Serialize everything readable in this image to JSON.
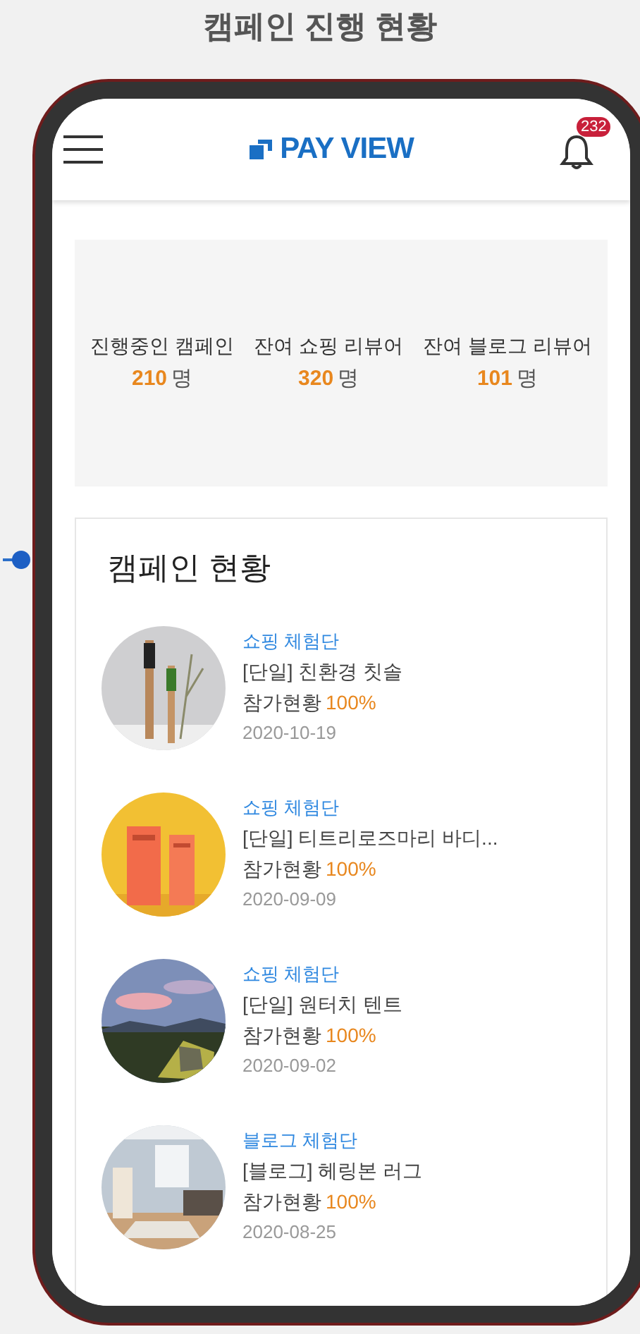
{
  "page_title": "캠페인 진행 현황",
  "header": {
    "logo": "PAY VIEW",
    "notification_count": "232"
  },
  "stats": [
    {
      "label": "진행중인 캠페인",
      "value": "210",
      "unit": "명"
    },
    {
      "label": "잔여 쇼핑 리뷰어",
      "value": "320",
      "unit": "명"
    },
    {
      "label": "잔여 블로그 리뷰어",
      "value": "101",
      "unit": "명"
    }
  ],
  "campaigns": {
    "title": "캠페인 현황",
    "items": [
      {
        "category": "쇼핑 체험단",
        "name": "[단일] 친환경 칫솔",
        "progress_label": "참가현황",
        "progress": "100%",
        "date": "2020-10-19"
      },
      {
        "category": "쇼핑 체험단",
        "name": "[단일] 티트리로즈마리 바디...",
        "progress_label": "참가현황",
        "progress": "100%",
        "date": "2020-09-09"
      },
      {
        "category": "쇼핑 체험단",
        "name": "[단일] 원터치 텐트",
        "progress_label": "참가현황",
        "progress": "100%",
        "date": "2020-09-02"
      },
      {
        "category": "블로그 체험단",
        "name": "[블로그] 헤링본 러그",
        "progress_label": "참가현황",
        "progress": "100%",
        "date": "2020-08-25"
      }
    ]
  }
}
